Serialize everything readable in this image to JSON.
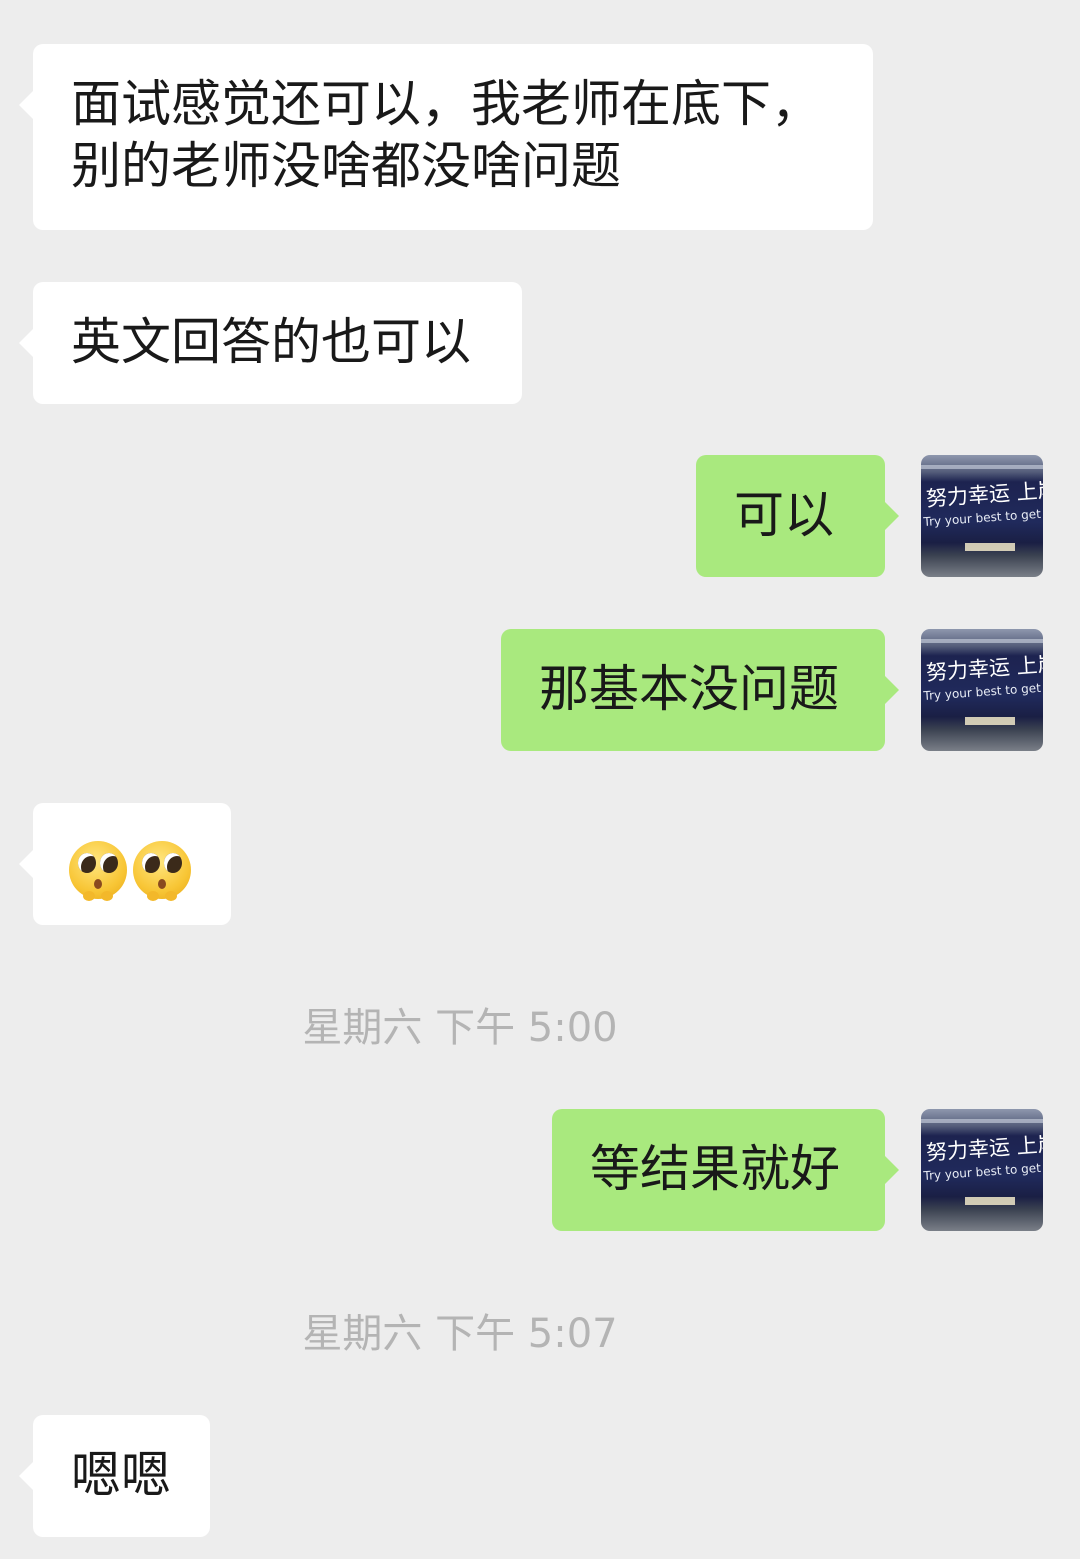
{
  "chat": {
    "messages": [
      {
        "sender": "other",
        "text": "面试感觉还可以，我老师在底下，\n别的老师没啥都没啥问题"
      },
      {
        "sender": "other",
        "text": "英文回答的也可以"
      },
      {
        "sender": "me",
        "text": "可以"
      },
      {
        "sender": "me",
        "text": "那基本没问题"
      },
      {
        "sender": "other",
        "emojis": [
          "pleading-face",
          "pleading-face"
        ]
      },
      {
        "sender": "me",
        "text": "等结果就好"
      },
      {
        "sender": "other",
        "text": "嗯嗯"
      }
    ],
    "timestamps": [
      "星期六 下午 5:00",
      "星期六 下午 5:07"
    ]
  },
  "self_avatar": {
    "line_cn": "努力幸运 上岸",
    "line_en": "Try your best to get ashore"
  },
  "colors": {
    "background": "#ededed",
    "incoming_bubble": "#ffffff",
    "outgoing_bubble": "#a9e97e",
    "timestamp_text": "#b4b4b4"
  }
}
